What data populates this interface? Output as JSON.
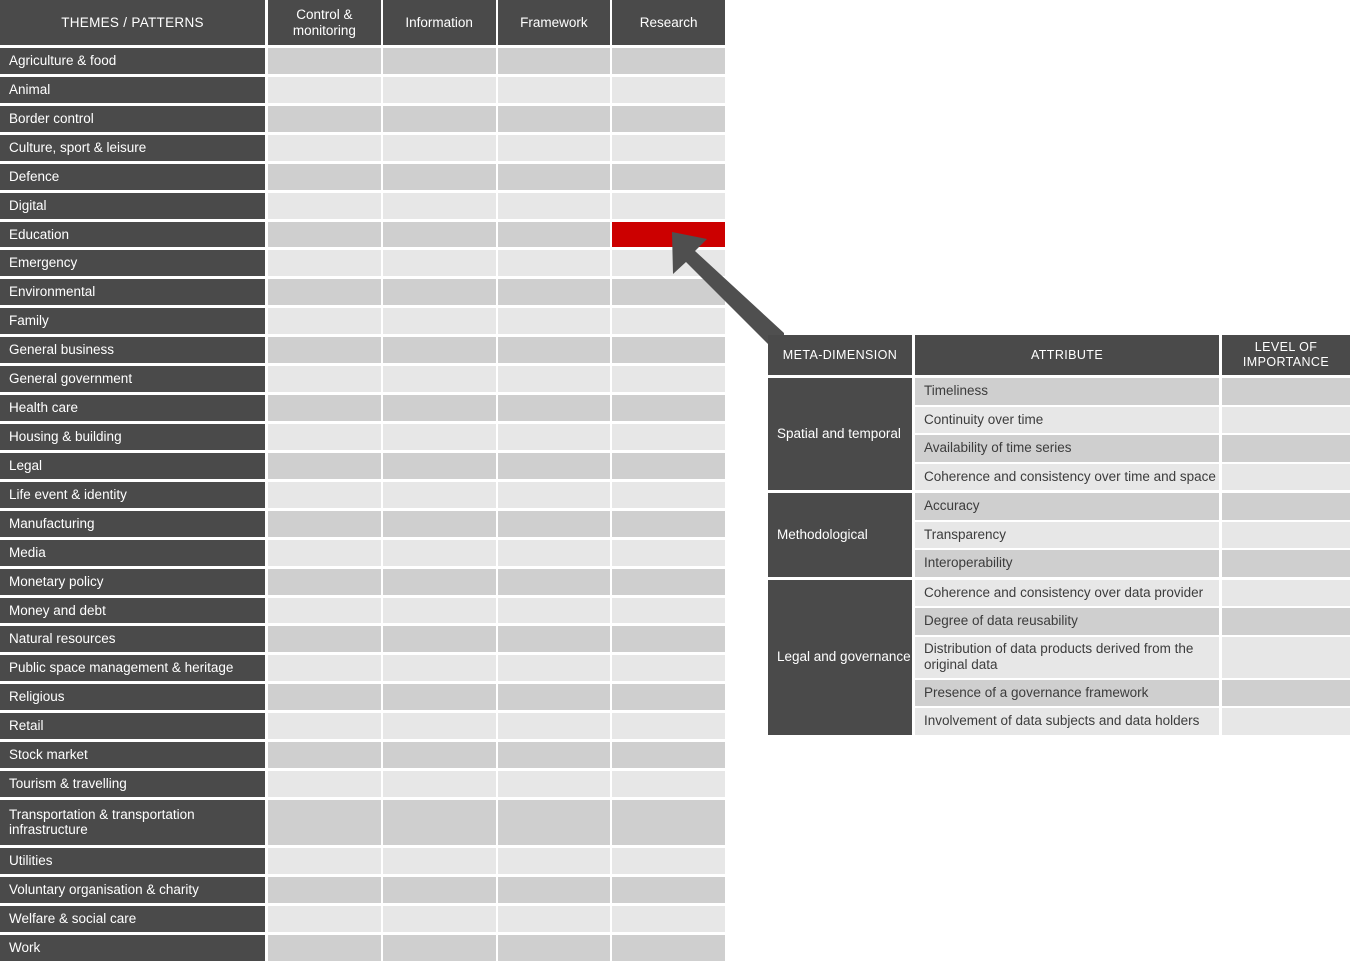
{
  "themes_matrix": {
    "header": {
      "row_label": "THEMES / PATTERNS",
      "columns": [
        "Control & monitoring",
        "Information",
        "Framework",
        "Research"
      ]
    },
    "rows": [
      {
        "label": "Agriculture & food"
      },
      {
        "label": "Animal"
      },
      {
        "label": "Border control"
      },
      {
        "label": "Culture, sport & leisure"
      },
      {
        "label": "Defence"
      },
      {
        "label": "Digital"
      },
      {
        "label": "Education",
        "highlight_column": 3
      },
      {
        "label": "Emergency"
      },
      {
        "label": "Environmental"
      },
      {
        "label": "Family"
      },
      {
        "label": "General business"
      },
      {
        "label": "General government"
      },
      {
        "label": "Health care"
      },
      {
        "label": "Housing & building"
      },
      {
        "label": "Legal"
      },
      {
        "label": "Life event & identity"
      },
      {
        "label": "Manufacturing"
      },
      {
        "label": "Media"
      },
      {
        "label": "Monetary policy"
      },
      {
        "label": "Money and debt"
      },
      {
        "label": "Natural resources"
      },
      {
        "label": "Public space management & heritage"
      },
      {
        "label": "Religious"
      },
      {
        "label": "Retail"
      },
      {
        "label": "Stock market"
      },
      {
        "label": "Tourism & travelling"
      },
      {
        "label": "Transportation & transportation infrastructure",
        "tall": true
      },
      {
        "label": "Utilities"
      },
      {
        "label": "Voluntary organisation & charity"
      },
      {
        "label": "Welfare & social care"
      },
      {
        "label": "Work"
      }
    ]
  },
  "meta_table": {
    "header": {
      "meta_dimension": "META-DIMENSION",
      "attribute": "ATTRIBUTE",
      "level_of_importance": "LEVEL OF IMPORTANCE"
    },
    "groups": [
      {
        "dimension": "Spatial and temporal",
        "attributes": [
          "Timeliness",
          "Continuity over time",
          "Availability of time series",
          "Coherence and consistency over time and space"
        ]
      },
      {
        "dimension": "Methodological",
        "attributes": [
          "Accuracy",
          "Transparency",
          "Interoperability"
        ]
      },
      {
        "dimension": "Legal and governance",
        "attributes": [
          "Coherence and consistency over data provider",
          "Degree of data reusability",
          "Distribution of data products derived from the original data",
          "Presence of a governance framework",
          "Involvement of data subjects and data holders"
        ]
      }
    ]
  },
  "connector": {
    "icon": "block-arrow-up-left",
    "from": "meta-dimension-table",
    "to": "education-research-cell"
  },
  "colors": {
    "dark_header": "#4a4a4a",
    "cell_dark": "#cfcfcf",
    "cell_light": "#e7e7e7",
    "highlight_red": "#cc0000",
    "arrow": "#4f4f4f"
  }
}
